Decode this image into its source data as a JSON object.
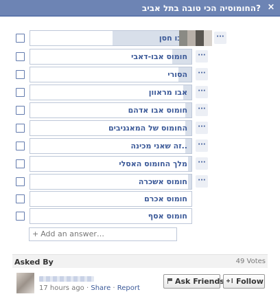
{
  "dialog": {
    "title": "?החומוסיה הכי טובה בתל אביב",
    "close_label": "×"
  },
  "options": [
    {
      "label": "אבו חסן",
      "share": 0.49
    },
    {
      "label": "חומוס אבו-דאבי",
      "share": 0.12
    },
    {
      "label": "הסורי",
      "share": 0.08
    },
    {
      "label": "אבו מראוון",
      "share": 0.05
    },
    {
      "label": "חומוס אבו אדהם",
      "share": 0.04
    },
    {
      "label": "החומוס של המאגניבים",
      "share": 0.04
    },
    {
      "label": "..זה שאני מכינה",
      "share": 0.04
    },
    {
      "label": "מלך החומוס האסלי",
      "share": 0.02
    },
    {
      "label": "חומוס אשכרה",
      "share": 0.02
    },
    {
      "label": "חומוס אכרם",
      "share": 0
    },
    {
      "label": "חומוס אסף",
      "share": 0
    }
  ],
  "more_label": "···",
  "add_answer": {
    "plus": "+",
    "placeholder": "Add an answer…"
  },
  "asked_by": {
    "label": "Asked By",
    "votes": "49 Votes"
  },
  "asker": {
    "time": "17 hours ago",
    "separator": "·",
    "share_link": "Share",
    "report_link": "Report"
  },
  "buttons": {
    "ask_friends": "Ask Friends",
    "ask_icon": "flag-icon",
    "follow": "Follow",
    "follow_icon": "plus-one-icon"
  },
  "colors": {
    "header": "#6d84b4",
    "fill": "#d8dfea",
    "link": "#3b5998"
  }
}
